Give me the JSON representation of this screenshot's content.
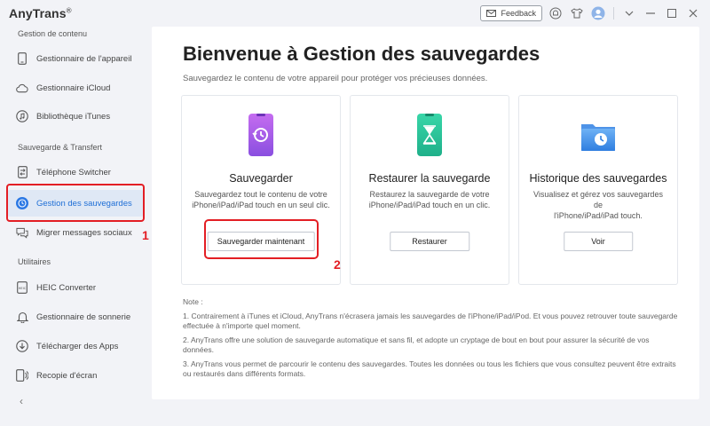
{
  "app": {
    "name": "AnyTrans",
    "mark": "®"
  },
  "titlebar": {
    "feedback_label": "Feedback"
  },
  "sidebar": {
    "sections": [
      {
        "label": "Gestion de contenu"
      },
      {
        "label": "Sauvegarde & Transfert"
      },
      {
        "label": "Utilitaires"
      }
    ],
    "items": [
      {
        "label": "Gestionnaire de l'appareil",
        "icon": "device-icon"
      },
      {
        "label": "Gestionnaire iCloud",
        "icon": "cloud-icon"
      },
      {
        "label": "Bibliothèque iTunes",
        "icon": "music-icon"
      },
      {
        "label": "Téléphone Switcher",
        "icon": "phone-switch-icon"
      },
      {
        "label": "Gestion des sauvegardes",
        "icon": "backup-clock-icon",
        "active": true
      },
      {
        "label": "Migrer messages sociaux",
        "icon": "chat-icon"
      },
      {
        "label": "HEIC Converter",
        "icon": "heic-icon"
      },
      {
        "label": "Gestionnaire de sonnerie",
        "icon": "bell-icon"
      },
      {
        "label": "Télécharger des Apps",
        "icon": "download-icon"
      },
      {
        "label": "Recopie d'écran",
        "icon": "screen-mirror-icon"
      }
    ],
    "collapse_glyph": "‹"
  },
  "annotations": {
    "step1": "1",
    "step2": "2"
  },
  "main": {
    "title": "Bienvenue à Gestion des sauvegardes",
    "subtitle": "Sauvegardez le contenu de votre appareil pour protéger vos précieuses données.",
    "cards": [
      {
        "title": "Sauvegarder",
        "desc1": "Sauvegardez tout le contenu de votre",
        "desc2": "iPhone/iPad/iPad touch en un seul clic.",
        "button": "Sauvegarder maintenant"
      },
      {
        "title": "Restaurer la sauvegarde",
        "desc1": "Restaurez la sauvegarde de votre",
        "desc2": "iPhone/iPad/iPad touch en un clic.",
        "button": "Restaurer"
      },
      {
        "title": "Historique des sauvegardes",
        "desc1": "Visualisez et gérez vos sauvegardes de",
        "desc2": "l'iPhone/iPad/iPad touch.",
        "button": "Voir"
      }
    ],
    "note_title": "Note :",
    "notes": [
      "1. Contrairement à iTunes et iCloud, AnyTrans n'écrasera jamais les sauvegardes de l'iPhone/iPad/iPod. Et vous pouvez retrouver toute sauvegarde effectuée à n'importe quel moment.",
      "2. AnyTrans offre une solution de sauvegarde automatique et sans fil, et adopte un cryptage de bout en bout pour assurer la sécurité de vos données.",
      "3. AnyTrans vous permet de parcourir le contenu des sauvegardes. Toutes les données ou tous les fichiers que vous consultez peuvent être extraits ou restaurés dans différents formats."
    ]
  },
  "colors": {
    "accent": "#2b78e4",
    "highlight": "#e31e24",
    "active_bg": "#dfe8f5"
  }
}
